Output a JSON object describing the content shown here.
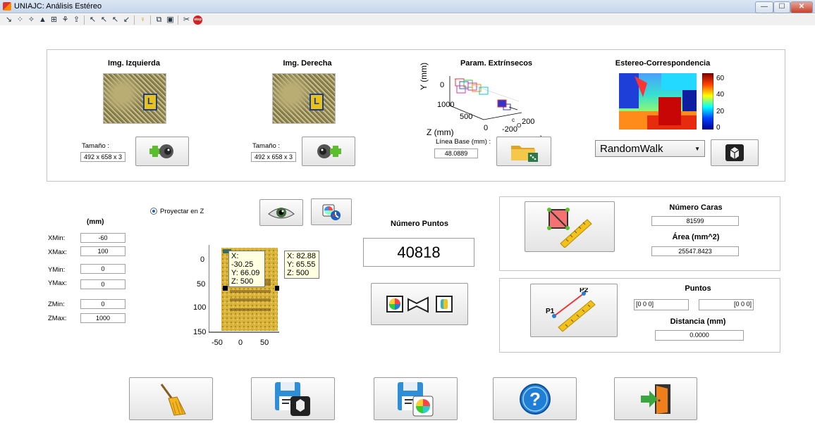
{
  "window": {
    "title": "UNIAJC: Análisis Estéreo",
    "min": "—",
    "max": "☐",
    "close": "✕"
  },
  "toolbar": {
    "icons": [
      "draw-line-icon",
      "points-icon",
      "tool-icon",
      "triangle-icon",
      "grid-icon",
      "network-icon",
      "upload-icon",
      "cursor-a-icon",
      "cursor-b-icon",
      "cursor-c-icon",
      "cursor-d-icon",
      "bulb-icon",
      "cube-icon",
      "frame-icon",
      "scissors-icon",
      "stop-icon"
    ],
    "stop_label": "stop"
  },
  "images": {
    "left": {
      "title": "Img. Izquierda",
      "size_label": "Tamaño :",
      "size_value": "492 x 658 x 3"
    },
    "right": {
      "title": "Img. Derecha",
      "size_label": "Tamaño :",
      "size_value": "492 x 658 x 3"
    },
    "book_letter": "L"
  },
  "extrinsic": {
    "title": "Param. Extrínsecos",
    "ylabel": "Y (mm)",
    "zlabel": "Z (mm)",
    "xlabel_partial": "m)",
    "ticks": {
      "y0": "0",
      "z1000": "1000",
      "z500": "500",
      "z0": "0",
      "x200": "200",
      "xm200": "-200",
      "c": "c",
      "o": "O"
    },
    "baseline_label": "Línea Base (mm) :",
    "baseline_value": "48.0889"
  },
  "stereo": {
    "title": "Estereo-Correspondencia",
    "colorbar_ticks": [
      "60",
      "40",
      "20",
      "0"
    ],
    "algorithm": "RandomWalk"
  },
  "limits": {
    "unit": "(mm)",
    "project_label": "Proyectar en Z",
    "xmin_label": "XMin:",
    "xmin": "-60",
    "xmax_label": "XMax:",
    "xmax": "100",
    "ymin_label": "YMin:",
    "ymin": "0",
    "ymax_label": "YMax:",
    "ymax": "0",
    "zmin_label": "ZMin:",
    "zmin": "0",
    "zmax_label": "ZMax:",
    "zmax": "1000"
  },
  "cloud_plot": {
    "yticks": [
      "0",
      "50",
      "100",
      "150"
    ],
    "xticks": [
      "-50",
      "0",
      "50"
    ],
    "tip1": {
      "x": "X: -30.25",
      "y": "Y: 66.09",
      "z": "Z: 500"
    },
    "tip2": {
      "x": "X: 82.88",
      "y": "Y: 65.55",
      "z": "Z: 500"
    }
  },
  "points": {
    "title": "Número Puntos",
    "value": "40818"
  },
  "mesh": {
    "faces_title": "Número Caras",
    "faces_value": "81599",
    "area_title": "Área (mm^2)",
    "area_value": "25547.8423"
  },
  "distance": {
    "points_title": "Puntos",
    "p1_value": "[0 0 0]",
    "p2_value": "[0 0 0]",
    "dist_title": "Distancia (mm)",
    "dist_value": "0.0000",
    "p1": "P1",
    "p2": "P2"
  },
  "colors": {
    "accent_green": "#5cbd2e",
    "help_blue": "#1f7fd6",
    "ruler_yellow": "#f2c21b",
    "exit_green": "#3aa640"
  }
}
